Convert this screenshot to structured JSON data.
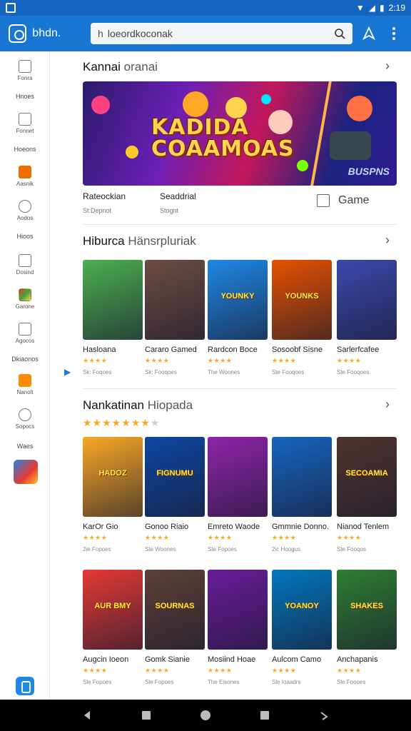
{
  "status_bar": {
    "time": "2:19"
  },
  "app_bar": {
    "app_name": "bhdn.",
    "search_prefix": "h",
    "search_text": "loeordkoconak"
  },
  "sidebar": {
    "items": [
      {
        "label": "Fonra",
        "icon": "window-icon"
      },
      {
        "label": "Fonnet",
        "icon": "frame-icon"
      },
      {
        "label": "Aasnik",
        "icon": "calendar-icon"
      },
      {
        "label": "Aodos",
        "icon": "leaf-icon"
      },
      {
        "label": "Dosind",
        "icon": "calendar-icon"
      },
      {
        "label": "Garone",
        "icon": "game-icon"
      },
      {
        "label": "Agocos",
        "icon": "bell-icon"
      },
      {
        "label": "Nanolt",
        "icon": "controller-icon"
      },
      {
        "label": "Sopocs",
        "icon": "chat-icon"
      }
    ],
    "headings": [
      "Hnoes",
      "Hoeons",
      "Hioos",
      "Dkiaonos",
      "Waes"
    ]
  },
  "sections": {
    "featured": {
      "title": "Kannai",
      "title_light": "oranai",
      "banner_title": "KADIDA\nCOAAMOAS",
      "banner_sub": "BUSPNS",
      "info": [
        {
          "title": "Rateockian",
          "sub": "St:Depnot"
        },
        {
          "title": "Seaddrial",
          "sub": "Stognt"
        }
      ],
      "game_link": "Game"
    },
    "popular": {
      "title": "Hiburca",
      "title_light": "Hänsrpluriak",
      "cards": [
        {
          "name": "Hasloana",
          "stars": "★★★★",
          "sub": "Sk: Foqoes",
          "bg": "#4caf50",
          "label": ""
        },
        {
          "name": "Cararo Gamed",
          "stars": "★★★★",
          "sub": "Sk: Fooqoes",
          "bg": "#6d4c41",
          "label": ""
        },
        {
          "name": "Rardcon Boce",
          "stars": "★★★★",
          "sub": "The Woones",
          "bg": "#1e88e5",
          "label": "YOUNKY"
        },
        {
          "name": "Sosoobf Sisne",
          "stars": "★★★★",
          "sub": "Ste Fooqoes",
          "bg": "#e65100",
          "label": "YOUNKS"
        },
        {
          "name": "Sarlerfcafee",
          "stars": "★★★★",
          "sub": "Ste Fooqoes",
          "bg": "#3949ab",
          "label": ""
        }
      ]
    },
    "recommended": {
      "title": "Nankatinan",
      "title_light": "Hiopada",
      "stars": "★★★★★★★",
      "stars_off": "★",
      "row1": [
        {
          "name": "KarOr Gio",
          "stars": "★★★★",
          "sub": "2ie Fopoes",
          "bg": "#f9a825",
          "label": "HADOZ"
        },
        {
          "name": "Gonoo Riaio",
          "stars": "★★★★",
          "sub": "Ste Woones",
          "bg": "#0d47a1",
          "label": "FIGNUMU"
        },
        {
          "name": "Emreto Waode",
          "stars": "★★★★",
          "sub": "Ste Fopoes",
          "bg": "#8e24aa",
          "label": ""
        },
        {
          "name": "Gmmnie Donno.",
          "stars": "★★★★",
          "sub": "2ic Hoogus",
          "bg": "#1565c0",
          "label": ""
        },
        {
          "name": "Nianod Tenlem",
          "stars": "★★★★",
          "sub": "Ste Fooqos",
          "bg": "#4e342e",
          "label": "SECOAMIA"
        }
      ],
      "row2": [
        {
          "name": "Augcin Ioeon",
          "stars": "★★★★",
          "sub": "Sle Fopoes",
          "bg": "#e53935",
          "label": "AUR BMY"
        },
        {
          "name": "Gomk Sianie",
          "stars": "★★★★",
          "sub": "Sle Fopoes",
          "bg": "#5d4037",
          "label": "SOURNAS"
        },
        {
          "name": "Mosiind Hoae",
          "stars": "★★★★",
          "sub": "The Eisones",
          "bg": "#6a1b9a",
          "label": ""
        },
        {
          "name": "Aulcom Camo",
          "stars": "★★★★",
          "sub": "Sle Ioaadrs",
          "bg": "#0277bd",
          "label": "YOANOY"
        },
        {
          "name": "Anchapanis",
          "stars": "★★★★",
          "sub": "Sle Foooes",
          "bg": "#2e7d32",
          "label": "SHAKES"
        }
      ]
    }
  }
}
